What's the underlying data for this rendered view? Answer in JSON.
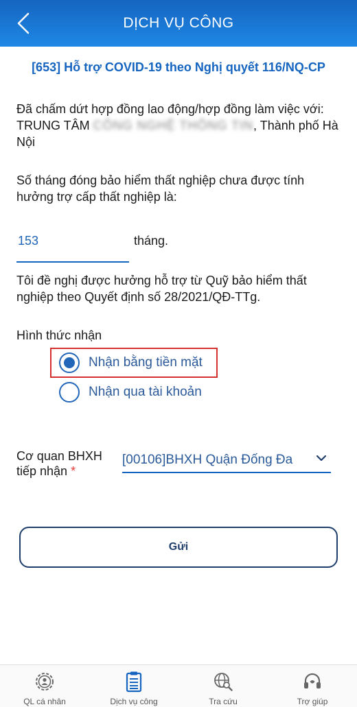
{
  "header": {
    "title": "DỊCH VỤ CÔNG",
    "back_icon": "chevron-left-icon"
  },
  "service_title": "[653] Hỗ trợ COVID-19 theo Nghị quyết 116/NQ-CP",
  "contract": {
    "line_start": "Đã chấm dứt hợp đồng  lao động/hợp đồng làm việc với: TRUNG TÂM ",
    "redacted": "CÔNG NGHỆ THÔNG TIN",
    "line_end": ", Thành phố Hà Nội"
  },
  "months_question": "Số tháng đóng bảo hiểm thất nghiệp chưa được tính hưởng trợ cấp thất nghiệp là:",
  "months_value": "153",
  "months_unit": "tháng.",
  "request_text": "Tôi đề nghị được hưởng hỗ trợ từ Quỹ bảo hiểm thất nghiệp theo Quyết định số 28/2021/QĐ-TTg.",
  "receive": {
    "label": "Hình thức nhận",
    "options": [
      {
        "label": "Nhận bằng tiền mặt",
        "selected": true
      },
      {
        "label": "Nhận qua tài khoản",
        "selected": false
      }
    ]
  },
  "agency": {
    "label": "Cơ quan BHXH tiếp nhận",
    "required_mark": "*",
    "value": "[00106]BHXH Quận Đống Đa"
  },
  "submit_label": "Gửi",
  "nav": [
    {
      "label": "QL cá nhân",
      "icon": "person-gear-icon"
    },
    {
      "label": "Dịch vụ công",
      "icon": "clipboard-icon"
    },
    {
      "label": "Tra cứu",
      "icon": "globe-search-icon"
    },
    {
      "label": "Trợ giúp",
      "icon": "headset-icon"
    }
  ],
  "colors": {
    "header": "#1976d2",
    "accent": "#1565c0",
    "highlight": "#d32f2f",
    "required": "#e53935"
  }
}
